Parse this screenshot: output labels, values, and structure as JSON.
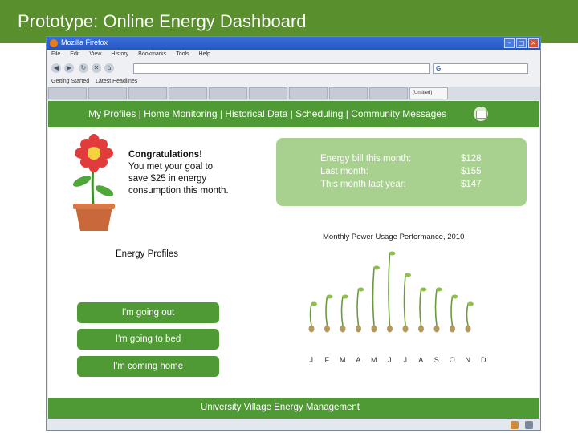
{
  "slide": {
    "title": "Prototype: Online Energy Dashboard"
  },
  "browser": {
    "window_title": "Mozilla Firefox",
    "menu": [
      "File",
      "Edit",
      "View",
      "History",
      "Bookmarks",
      "Tools",
      "Help"
    ],
    "bookmarks": [
      "Getting Started",
      "Latest Headlines"
    ],
    "tabs": [
      "",
      "",
      "",
      "",
      "",
      "",
      "",
      "",
      "",
      "(Untitled)"
    ],
    "url": "",
    "search_placeholder": ""
  },
  "site": {
    "nav_text": "My Profiles | Home Monitoring | Historical Data | Scheduling | Community Messages",
    "congrats": {
      "line1": "Congratulations!",
      "line2": "You met your goal to",
      "line3": "save $25 in energy",
      "line4": "consumption this month."
    },
    "bill": {
      "rows": [
        {
          "label": "Energy bill this month:",
          "value": "$128"
        },
        {
          "label": "Last month:",
          "value": "$155"
        },
        {
          "label": "This month last year:",
          "value": "$147"
        }
      ]
    },
    "chart_title": "Monthly Power Usage Performance, 2010",
    "profiles": {
      "title": "Energy Profiles",
      "buttons": [
        "I'm going out",
        "I'm going to bed",
        "I'm coming home"
      ]
    },
    "footer": "University Village Energy Management"
  },
  "chart_data": {
    "type": "bar",
    "title": "Monthly Power Usage Performance, 2010",
    "categories": [
      "J",
      "F",
      "M",
      "A",
      "M",
      "J",
      "J",
      "A",
      "S",
      "O",
      "N",
      "D"
    ],
    "values": [
      3,
      4,
      4,
      5,
      8,
      10,
      7,
      5,
      5,
      4,
      3,
      null
    ],
    "colors": {
      "stem": "#6b9a3a",
      "leaf": "#8fbf4e",
      "seed": "#b59a5e"
    }
  },
  "colors": {
    "header_green": "#5a8f2e",
    "site_green": "#4f9a34",
    "box_green": "#a8d08e"
  }
}
